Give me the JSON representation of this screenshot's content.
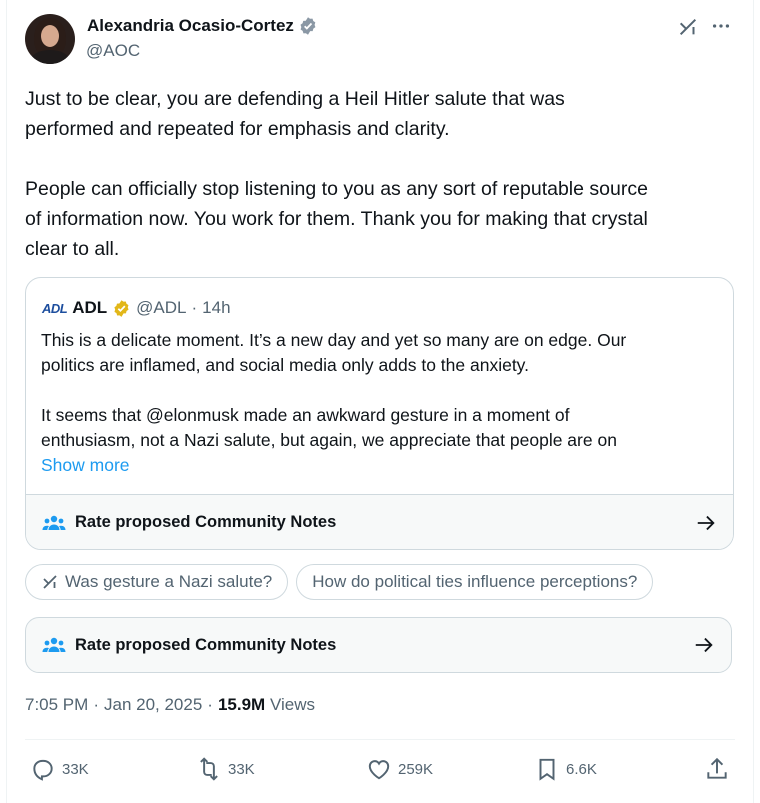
{
  "author": {
    "name": "Alexandria Ocasio-Cortez",
    "handle": "@AOC",
    "verified": true
  },
  "tweet": {
    "text": "Just to be clear, you are defending a Heil Hitler salute that was\nperformed and repeated for emphasis and clarity.\n\nPeople can officially stop listening to you as any sort of reputable source\nof information now. You work for them. Thank you for making that crystal\nclear to all."
  },
  "quote": {
    "logo_text": "ADL",
    "name": "ADL",
    "handle": "@ADL",
    "separator": "·",
    "time": "14h",
    "text": "This is a delicate moment. It’s a new day and yet so many are on edge. Our\npolitics are inflamed, and social media only adds to the anxiety.\n\nIt seems that @elonmusk made an awkward gesture in a moment of\nenthusiasm, not a Nazi salute, but again, we appreciate that people are on",
    "show_more": "Show more",
    "notes_label": "Rate proposed Community Notes"
  },
  "chips": [
    {
      "label": "Was gesture a Nazi salute?",
      "icon": "grok-icon"
    },
    {
      "label": "How do political ties influence perceptions?"
    }
  ],
  "notes": {
    "label": "Rate proposed Community Notes"
  },
  "meta": {
    "time": "7:05 PM",
    "dot1": "·",
    "date": "Jan 20, 2025",
    "dot2": "·",
    "views_count": "15.9M",
    "views_label": "Views"
  },
  "actions": {
    "replies": "33K",
    "reposts": "33K",
    "likes": "259K",
    "bookmarks": "6.6K"
  },
  "colors": {
    "accent": "#1d9bf0",
    "verified_blue": "#1d9bf0",
    "verified_gold": "#e2b719",
    "secondary_text": "#536471"
  }
}
